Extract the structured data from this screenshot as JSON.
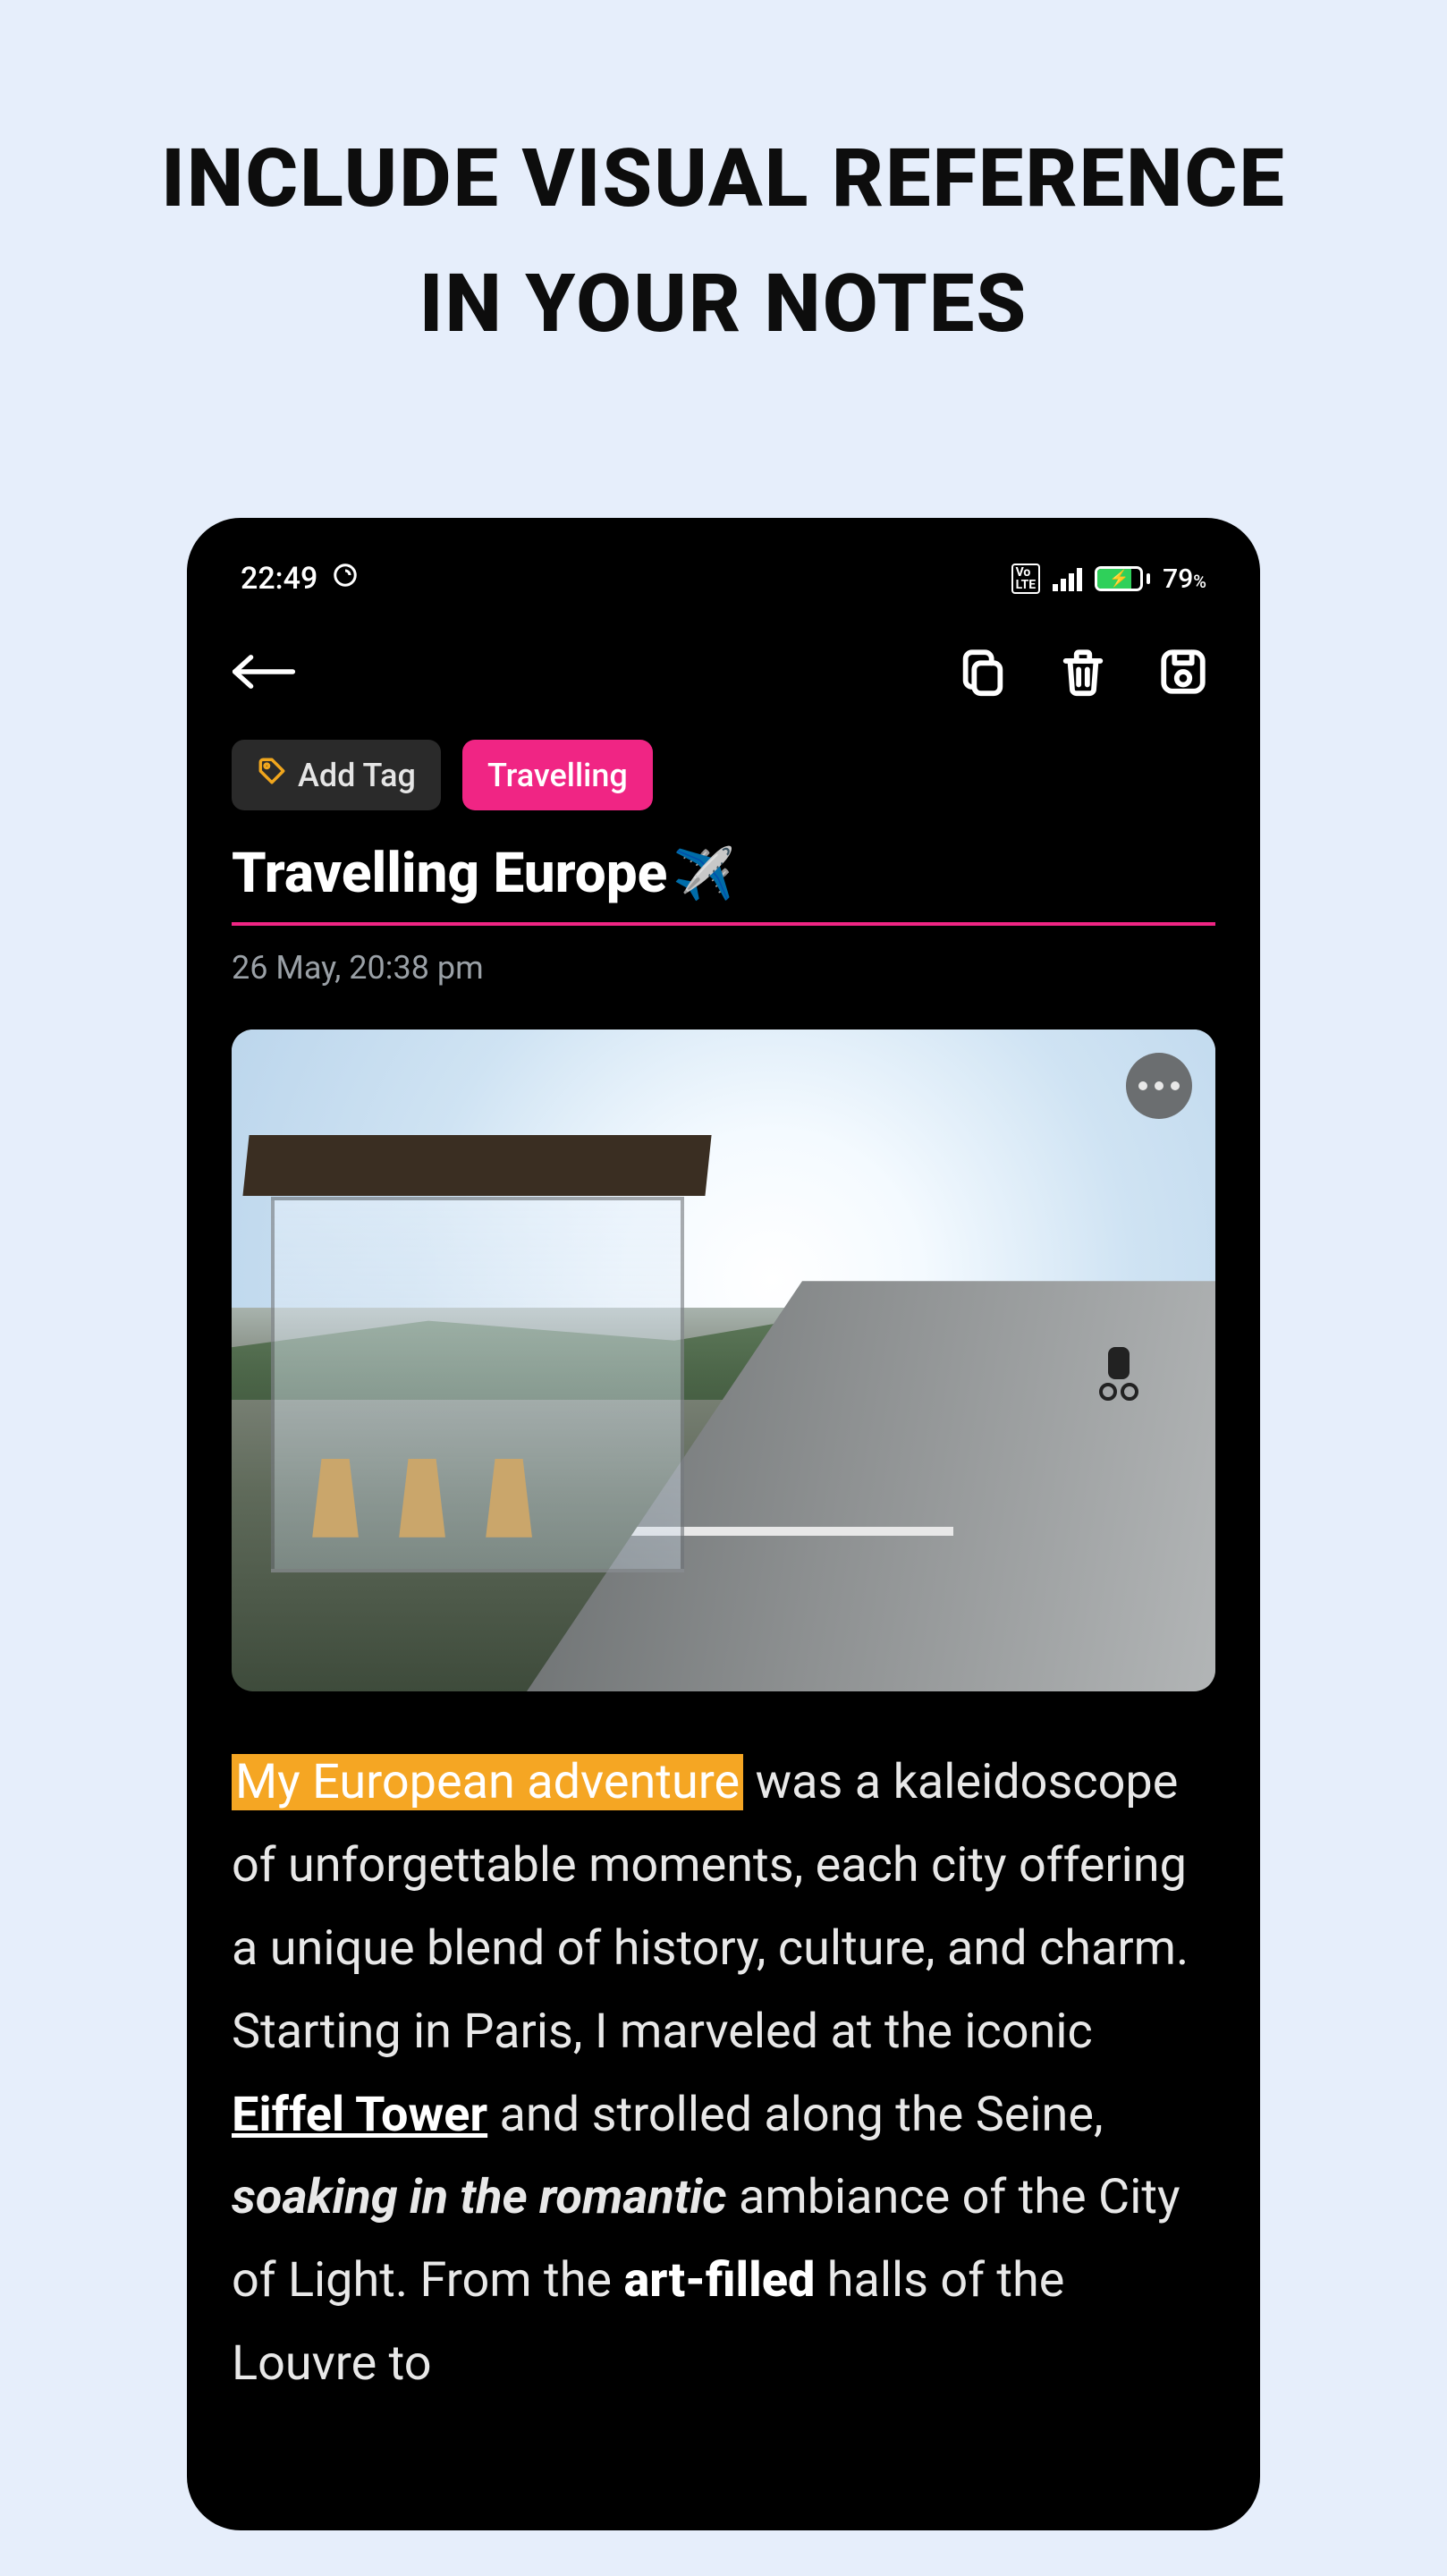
{
  "promo": {
    "line1": "INCLUDE VISUAL REFERENCE",
    "line2": "IN YOUR NOTES"
  },
  "status": {
    "time": "22:49",
    "volte": "Vo LTE",
    "battery_pct": "79",
    "battery_pct_suffix": "%"
  },
  "tags": {
    "add_label": "Add Tag",
    "items": [
      {
        "label": "Travelling",
        "color": "#f02584"
      }
    ]
  },
  "note": {
    "title": "Travelling Europe",
    "title_emoji": "✈️",
    "date": "26 May, 20:38 pm",
    "image_alt": "Glass bus shelter with wooden stools beside a countryside road, a motorcyclist riding past, hills and sunlight in the background",
    "body": {
      "highlight": "My European adventure",
      "p1a": " was a kaleidoscope of unforgettable moments, each city offering a unique blend of history, culture, and charm. Starting in Paris, I marveled at the iconic ",
      "eiffel": "Eiffel Tower",
      "p1b": " and strolled along the Seine, ",
      "romantic": "soaking in the romantic",
      "p1c": " ambiance of the City of Light. From the ",
      "artfilled": "art-filled",
      "p1d": " halls of the Louvre to"
    }
  },
  "icons": {
    "back": "back-arrow-icon",
    "copy": "copy-icon",
    "trash": "trash-icon",
    "save": "save-disk-icon",
    "tag": "tag-icon",
    "more": "more-horizontal-icon",
    "clock": "clock-icon"
  }
}
